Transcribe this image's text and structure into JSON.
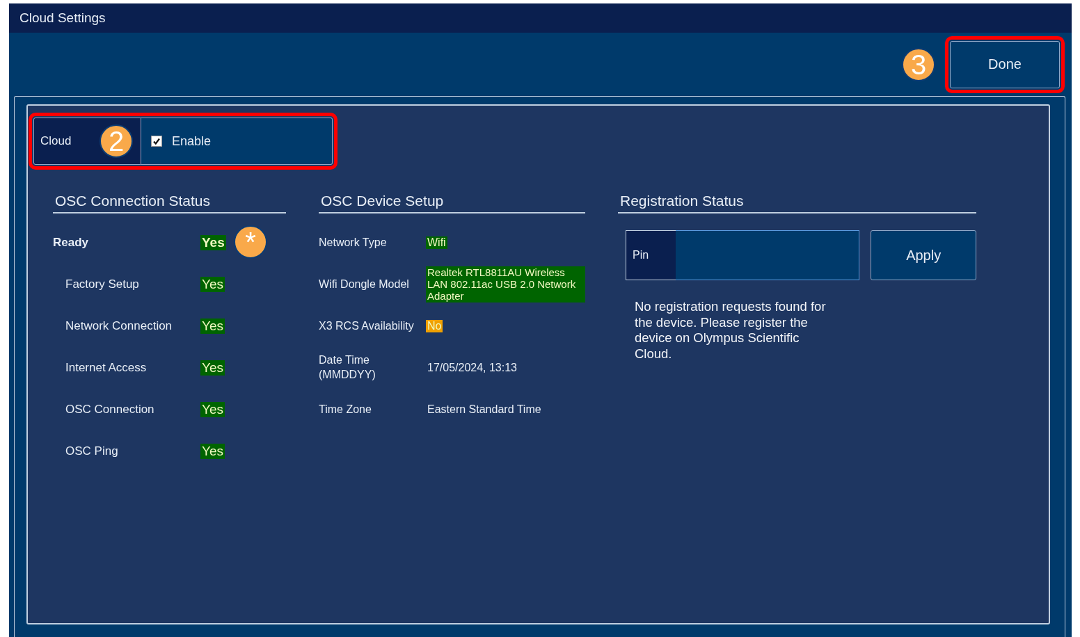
{
  "window": {
    "title": "Cloud Settings"
  },
  "header": {
    "done_button": "Done",
    "callout": "3"
  },
  "cloud": {
    "label": "Cloud",
    "callout": "2",
    "enable": {
      "label": "Enable",
      "checked": true
    }
  },
  "connection_status": {
    "heading": "OSC Connection Status",
    "callout": "*",
    "rows": [
      {
        "kind": "summary",
        "label": "Ready",
        "value": "Yes",
        "color": "#006400"
      },
      {
        "kind": "item",
        "label": "Factory Setup",
        "value": "Yes",
        "color": "#006400"
      },
      {
        "kind": "item",
        "label": "Network Connection",
        "value": "Yes",
        "color": "#006400"
      },
      {
        "kind": "item",
        "label": "Internet Access",
        "value": "Yes",
        "color": "#006400"
      },
      {
        "kind": "item",
        "label": "OSC Connection",
        "value": "Yes",
        "color": "#006400"
      },
      {
        "kind": "item",
        "label": "OSC Ping",
        "value": "Yes",
        "color": "#006400"
      }
    ]
  },
  "device_setup": {
    "heading": "OSC Device Setup",
    "rows": [
      {
        "label": "Network Type",
        "value": "Wifi",
        "color": "#006400"
      },
      {
        "label": "Wifi Dongle Model",
        "value": "Realtek RTL8811AU Wireless LAN 802.11ac USB 2.0 Network Adapter",
        "color": "#006400"
      },
      {
        "label": "X3 RCS Availability",
        "value": "No",
        "color": "#f0a000"
      },
      {
        "label": "Date Time (MMDDYY)",
        "value": "17/05/2024, 13:13"
      },
      {
        "label": "Time Zone",
        "value": "Eastern Standard Time"
      }
    ]
  },
  "registration": {
    "heading": "Registration Status",
    "pin_field": {
      "label": "Pin"
    },
    "apply_button": "Apply",
    "message": "No registration requests found for the device. Please register the device on Olympus Scientific Cloud."
  }
}
